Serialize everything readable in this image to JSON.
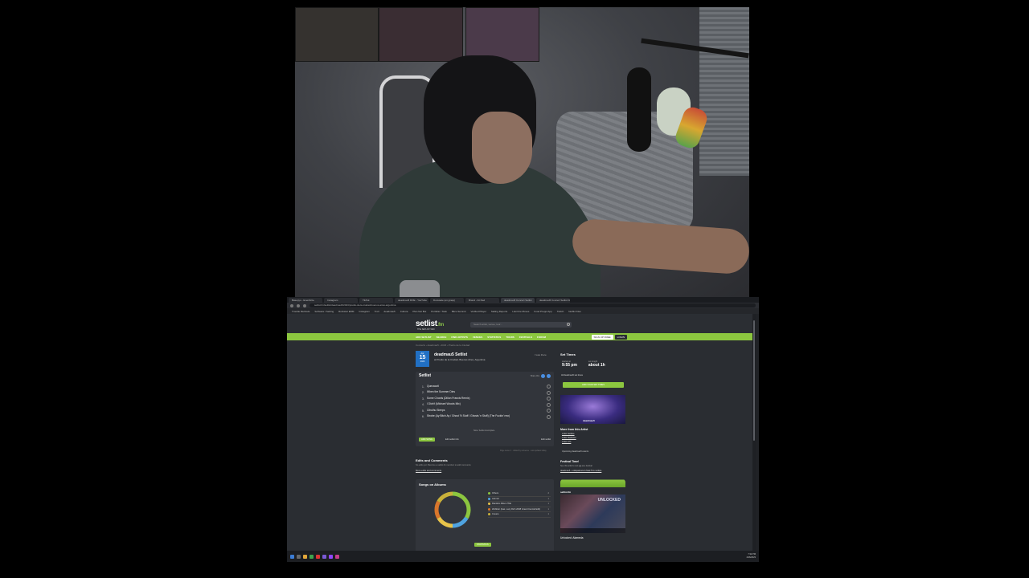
{
  "browser": {
    "tabs": [
      {
        "label": "Basepyo - Eventbrite",
        "active": false
      },
      {
        "label": "Instagram",
        "active": false
      },
      {
        "label": "TikTok",
        "active": false
      },
      {
        "label": "deadmau5 DOE - YouTube",
        "active": false
      },
      {
        "label": "Docusate (en grasp)",
        "active": false
      },
      {
        "label": "Brand - bit Red",
        "active": false
      },
      {
        "label": "deadmau5 Concert Setlist",
        "active": true
      },
      {
        "label": "deadmau5 Concert Setlist Dat",
        "active": false
      }
    ],
    "url": "setlist.fm/setlist/deadmau5/2023/predio-de-la-ciudad-buenos-aires-argentina",
    "bookmarks": [
      "Trouble Methods",
      "Software / Setting",
      "Rockstar EDM",
      "Instagram",
      "Troll",
      "deadmau5",
      "Cultura",
      "Plan Net Bot",
      "Portfolio / Task",
      "Bitco Summit",
      "Verified Player",
      "Sailing Reports",
      "Loki Fire Moves",
      "Food Preppi App",
      "Twitch",
      "Netflix Files"
    ]
  },
  "site": {
    "logo": "setlist",
    "logo_suffix": ".fm",
    "tagline": "THE SETLIST WIKI",
    "search_placeholder": "Search artist, venue, tour...",
    "nav": [
      "ADD SETLIST",
      "SEARCH",
      "FIND ARTISTS",
      "VENUES",
      "STATISTICS",
      "TOURS",
      "FESTIVALS",
      "FORUM"
    ],
    "signin_label": "SIGN UP FREE",
    "login_label": "LOGIN",
    "breadcrumb": "Concerts › deadmau5 › 2023 › Predio de la Ciudad",
    "date": {
      "month": "Apr",
      "day": "15",
      "year": "2023"
    },
    "title": "deadmau5 Setlist",
    "venue": "at Predio de la Ciudad, Buenos Aires, Argentina",
    "attended_label": "I was there",
    "setlist_heading": "Setlist",
    "share_label": "Share this",
    "songs": [
      "Quezacotl",
      "When the Summer Dies",
      "Some Chords (Dillon Francis Remix)",
      "I Didn't (Michael Woods Mix)",
      "Cthulhu Sleeps",
      "Strobe (Ay Bitch Ay / Ghost 'N Stuff / Ghosts 'n Stuff) (The Fuckin' rmx)"
    ],
    "note": "Note: Setlist incomplete",
    "add_button": "ADD SONG",
    "edit_info": "Edit setlist info",
    "edit_setlist": "Edit setlist",
    "meta_line": "Page views: 1 · Added by someone · Last updated today",
    "edits_title": "Edits and Comments",
    "edits_text": "No edits yet. Become a setlist.fm member to add comments",
    "edits_link": "More edits and comments",
    "albums_title": "Songs on Albums",
    "albums": [
      {
        "name": "Others",
        "count": "2",
        "color": "#8cc63f"
      },
      {
        "name": "4x4=12",
        "count": "1",
        "color": "#4fa3e0"
      },
      {
        "name": "Random Album Title",
        "count": "1",
        "color": "#e7c34a"
      },
      {
        "name": "Wobbler (feat. Lazy Rich 2008 Grand Central Edit)",
        "count": "1",
        "color": "#d9762b"
      },
      {
        "name": "Covers",
        "count": "1",
        "color": "#c9b13a"
      }
    ],
    "albums_button": "STATISTICS",
    "sidebar": {
      "set_times_title": "Set Times",
      "set_times": [
        {
          "label": "started at",
          "time": "9:55 pm"
        },
        {
          "label": "set length",
          "time": "about 1h"
        }
      ],
      "set_times_more": "All deadmau5 set times",
      "green_button": "ADD YOUR SET TIMES",
      "artist_image_label": "deadmau5",
      "more_title": "More from this Artist",
      "more_links": [
        "Artist Setlists",
        "Artist Statistics",
        "Artist Info"
      ],
      "events_link": "Upcoming deadmau5 events",
      "festival_title": "Festival Time!",
      "festival_text": "See this artist's next gig at a festival",
      "festival_link": "deadmau5 - Lollapalooza & Mad Tixs setlists",
      "video_label": "setlist.fm",
      "video_text": "UNLOCKED",
      "unlocked_caption": "Unlocked: Alameda"
    }
  },
  "taskbar": {
    "clock_time": "7:32 PM",
    "clock_date": "4/16/2023"
  }
}
